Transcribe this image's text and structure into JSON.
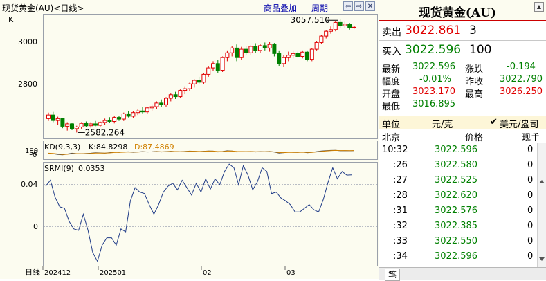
{
  "window": {
    "title": "现货黄金(AU)<日线>",
    "overlay_link": "商品叠加",
    "period_link": "周期",
    "btn_left": "⇦",
    "btn_right": "⇨",
    "btn_close": "✕"
  },
  "main_chart": {
    "k_label": "K",
    "y_ticks": [
      "3000",
      "2800"
    ],
    "high_label": "3057.510",
    "low_label": "2582.264"
  },
  "kd": {
    "label": "KD(9,3,3)",
    "k_text": "K:84.8298",
    "d_text": "D:87.4869",
    "axis_labels": [
      "100",
      "50",
      "0"
    ]
  },
  "srmi": {
    "label": "SRMI(9)",
    "value": "0.0353",
    "y_ticks": [
      "0.04",
      "0"
    ]
  },
  "x_axis": {
    "period": "日线",
    "labels": [
      "202412",
      "202501",
      "02",
      "03"
    ]
  },
  "colors": {
    "up": "#e00000",
    "down": "#008000",
    "accent": "#cc0000",
    "link": "#0000aa"
  },
  "quote": {
    "title": "现货黄金(AU)",
    "collapse_icon": "▲",
    "sell": {
      "label": "卖出",
      "price": "3022.861",
      "vol": "3"
    },
    "buy": {
      "label": "买入",
      "price": "3022.596",
      "vol": "100"
    },
    "stats": {
      "last_label": "最新",
      "last": "3022.596",
      "change_label": "涨跌",
      "change": "-0.194",
      "pct_label": "幅度",
      "pct": "-0.01%",
      "prev_label": "昨收",
      "prev": "3022.790",
      "open_label": "开盘",
      "open": "3023.170",
      "high_label": "最高",
      "high": "3026.250",
      "low_label": "最低",
      "low": "3016.895"
    },
    "unit": {
      "label": "单位",
      "value": "元/克",
      "check": "✔",
      "alt": "美元/盎司"
    },
    "ticks_header": {
      "place": "北京",
      "price": "价格",
      "hands": "现手"
    },
    "ticks": [
      {
        "time": "10:32",
        "price": "3022.596",
        "hands": "0"
      },
      {
        "time": ":26",
        "price": "3022.580",
        "hands": "0"
      },
      {
        "time": ":27",
        "price": "3022.525",
        "hands": "0"
      },
      {
        "time": ":28",
        "price": "3022.620",
        "hands": "0"
      },
      {
        "time": ":31",
        "price": "3022.576",
        "hands": "0"
      },
      {
        "time": ":32",
        "price": "3022.385",
        "hands": "0"
      },
      {
        "time": ":33",
        "price": "3022.550",
        "hands": "0"
      },
      {
        "time": ":34",
        "price": "3022.596",
        "hands": "0"
      }
    ],
    "tab_label": "笔"
  },
  "chart_data": [
    {
      "type": "candlestick",
      "title": "",
      "y_range": [
        2560,
        3075
      ],
      "y_ticks": [
        3000,
        2800
      ],
      "ohlc": [
        [
          2640,
          2665,
          2630,
          2655
        ],
        [
          2655,
          2668,
          2625,
          2632
        ],
        [
          2632,
          2648,
          2615,
          2640
        ],
        [
          2640,
          2642,
          2600,
          2608
        ],
        [
          2608,
          2625,
          2590,
          2618
        ],
        [
          2618,
          2622,
          2592,
          2598
        ],
        [
          2598,
          2610,
          2582,
          2605
        ],
        [
          2605,
          2625,
          2598,
          2620
        ],
        [
          2620,
          2628,
          2605,
          2610
        ],
        [
          2610,
          2625,
          2602,
          2618
        ],
        [
          2618,
          2630,
          2608,
          2612
        ],
        [
          2612,
          2628,
          2606,
          2624
        ],
        [
          2624,
          2640,
          2615,
          2632
        ],
        [
          2632,
          2646,
          2622,
          2628
        ],
        [
          2628,
          2650,
          2620,
          2645
        ],
        [
          2645,
          2652,
          2630,
          2638
        ],
        [
          2638,
          2665,
          2630,
          2660
        ],
        [
          2660,
          2672,
          2645,
          2650
        ],
        [
          2650,
          2670,
          2642,
          2665
        ],
        [
          2665,
          2680,
          2655,
          2672
        ],
        [
          2672,
          2690,
          2662,
          2668
        ],
        [
          2668,
          2690,
          2660,
          2685
        ],
        [
          2685,
          2700,
          2672,
          2690
        ],
        [
          2690,
          2712,
          2680,
          2705
        ],
        [
          2705,
          2720,
          2690,
          2698
        ],
        [
          2698,
          2730,
          2690,
          2725
        ],
        [
          2725,
          2745,
          2712,
          2740
        ],
        [
          2740,
          2752,
          2722,
          2732
        ],
        [
          2732,
          2762,
          2725,
          2758
        ],
        [
          2758,
          2775,
          2742,
          2765
        ],
        [
          2765,
          2790,
          2755,
          2785
        ],
        [
          2785,
          2805,
          2770,
          2800
        ],
        [
          2800,
          2815,
          2785,
          2792
        ],
        [
          2792,
          2830,
          2785,
          2825
        ],
        [
          2825,
          2860,
          2815,
          2852
        ],
        [
          2852,
          2880,
          2840,
          2870
        ],
        [
          2870,
          2885,
          2830,
          2842
        ],
        [
          2842,
          2900,
          2835,
          2895
        ],
        [
          2895,
          2925,
          2880,
          2915
        ],
        [
          2915,
          2942,
          2900,
          2935
        ],
        [
          2935,
          2950,
          2880,
          2895
        ],
        [
          2895,
          2940,
          2885,
          2930
        ],
        [
          2930,
          2945,
          2905,
          2915
        ],
        [
          2915,
          2948,
          2905,
          2942
        ],
        [
          2942,
          2955,
          2915,
          2925
        ],
        [
          2925,
          2952,
          2915,
          2945
        ],
        [
          2945,
          2958,
          2925,
          2935
        ],
        [
          2935,
          2960,
          2920,
          2950
        ],
        [
          2950,
          2956,
          2900,
          2912
        ],
        [
          2912,
          2925,
          2860,
          2870
        ],
        [
          2870,
          2905,
          2855,
          2895
        ],
        [
          2895,
          2920,
          2880,
          2905
        ],
        [
          2905,
          2925,
          2892,
          2912
        ],
        [
          2912,
          2920,
          2895,
          2900
        ],
        [
          2900,
          2925,
          2892,
          2918
        ],
        [
          2918,
          2925,
          2880,
          2888
        ],
        [
          2888,
          2935,
          2880,
          2930
        ],
        [
          2930,
          2965,
          2925,
          2958
        ],
        [
          2958,
          2990,
          2952,
          2985
        ],
        [
          2985,
          3010,
          2975,
          3005
        ],
        [
          3005,
          3025,
          2995,
          3012
        ],
        [
          3012,
          3048,
          3005,
          3042
        ],
        [
          3042,
          3057,
          3018,
          3028
        ],
        [
          3028,
          3045,
          3020,
          3035
        ],
        [
          3035,
          3040,
          3012,
          3020
        ],
        [
          3020,
          3026,
          3016,
          3022
        ]
      ],
      "annotations": [
        {
          "text": "3057.510",
          "kind": "high"
        },
        {
          "text": "2582.264",
          "kind": "low"
        }
      ]
    },
    {
      "type": "line",
      "title": "KD(9,3,3)",
      "y_range": [
        0,
        100
      ],
      "series": [
        {
          "name": "K",
          "color": "#505050",
          "values": [
            50,
            48,
            40,
            35,
            45,
            55,
            50,
            48,
            52,
            55,
            60,
            58,
            55,
            62,
            68,
            64,
            70,
            72,
            66,
            70,
            74,
            70,
            72,
            76,
            70,
            74,
            78,
            74,
            72,
            76,
            80,
            78,
            74,
            78,
            82,
            80,
            70,
            76,
            84,
            82,
            70,
            74,
            72,
            76,
            70,
            74,
            72,
            76,
            68,
            56,
            62,
            68,
            66,
            64,
            70,
            60,
            66,
            74,
            82,
            86,
            88,
            90,
            84,
            86,
            84,
            85
          ]
        },
        {
          "name": "D",
          "color": "#d08000",
          "values": [
            55,
            52,
            46,
            40,
            42,
            48,
            50,
            49,
            50,
            52,
            56,
            57,
            56,
            58,
            63,
            64,
            67,
            70,
            68,
            69,
            72,
            71,
            71,
            74,
            72,
            73,
            76,
            75,
            73,
            75,
            78,
            78,
            76,
            77,
            80,
            80,
            75,
            75,
            80,
            81,
            76,
            75,
            74,
            75,
            73,
            73,
            73,
            74,
            71,
            63,
            62,
            65,
            66,
            65,
            67,
            64,
            65,
            70,
            76,
            81,
            85,
            88,
            87,
            87,
            86,
            87
          ]
        }
      ]
    },
    {
      "type": "line",
      "title": "SRMI(9)",
      "y_ticks": [
        0.04,
        0
      ],
      "y_range": [
        -0.088,
        0.052
      ],
      "series": [
        {
          "name": "SRMI",
          "color": "#203c88",
          "values": [
            0.02,
            0.028,
            0.005,
            -0.008,
            -0.01,
            -0.028,
            -0.038,
            -0.04,
            -0.018,
            -0.04,
            -0.07,
            -0.082,
            -0.06,
            -0.05,
            -0.05,
            -0.06,
            -0.038,
            -0.042,
            0.0,
            0.018,
            0.012,
            0.01,
            -0.005,
            -0.018,
            -0.005,
            0.012,
            0.02,
            0.024,
            0.015,
            0.028,
            0.018,
            0.008,
            0.024,
            0.012,
            0.03,
            0.016,
            0.03,
            0.022,
            0.04,
            0.05,
            0.045,
            0.022,
            0.048,
            0.035,
            0.015,
            0.026,
            0.045,
            0.04,
            0.01,
            0.012,
            0.004,
            0.0,
            -0.005,
            -0.015,
            -0.015,
            -0.01,
            -0.005,
            -0.012,
            -0.015,
            0.002,
            0.025,
            0.045,
            0.03,
            0.04,
            0.035,
            0.0353
          ]
        }
      ]
    }
  ]
}
